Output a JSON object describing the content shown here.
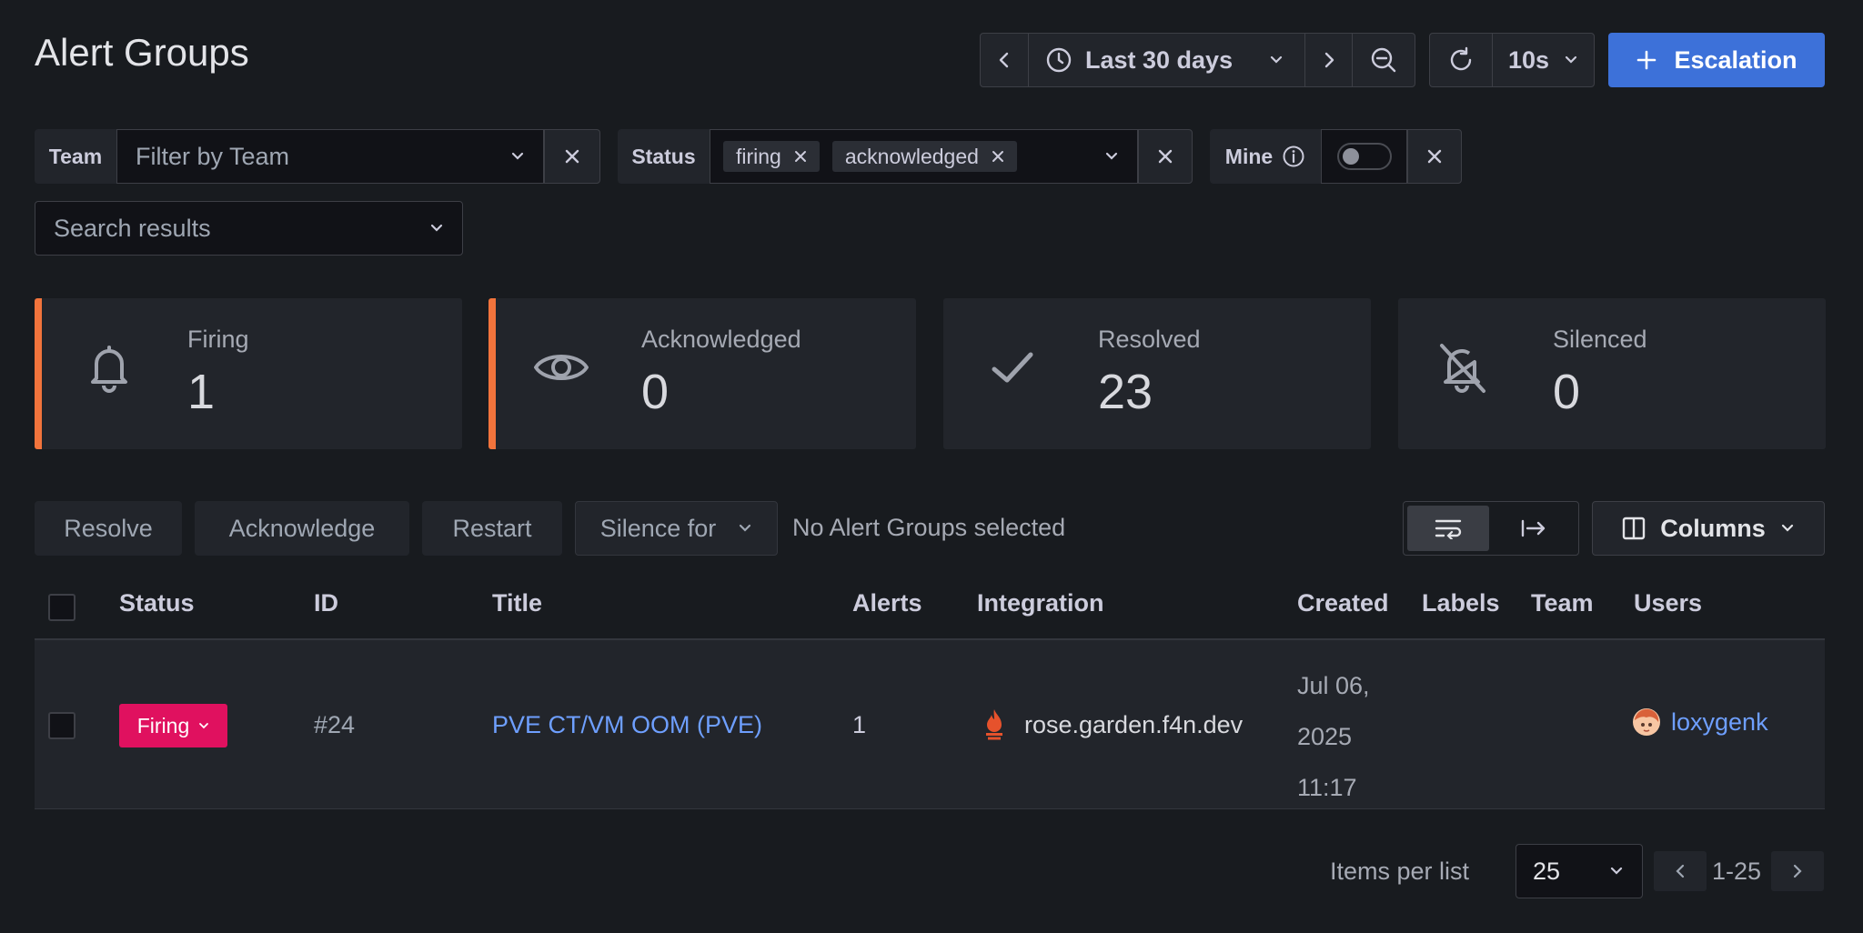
{
  "page": {
    "title": "Alert Groups"
  },
  "time_picker": {
    "range": "Last 30 days",
    "refresh_interval": "10s"
  },
  "escalation_button": {
    "label": "Escalation"
  },
  "filters": {
    "team": {
      "label": "Team",
      "placeholder": "Filter by Team"
    },
    "status": {
      "label": "Status",
      "chips": [
        "firing",
        "acknowledged"
      ]
    },
    "mine": {
      "label": "Mine",
      "enabled": false
    },
    "search": {
      "placeholder": "Search results"
    }
  },
  "stats": [
    {
      "label": "Firing",
      "value": "1",
      "icon": "bell-icon",
      "accent": true
    },
    {
      "label": "Acknowledged",
      "value": "0",
      "icon": "eye-icon",
      "accent": true
    },
    {
      "label": "Resolved",
      "value": "23",
      "icon": "check-icon",
      "accent": false
    },
    {
      "label": "Silenced",
      "value": "0",
      "icon": "bell-slash-icon",
      "accent": false
    }
  ],
  "bulk_actions": {
    "resolve": "Resolve",
    "acknowledge": "Acknowledge",
    "restart": "Restart",
    "silence_for": "Silence for",
    "selection_text": "No Alert Groups selected"
  },
  "columns_button": {
    "label": "Columns"
  },
  "table": {
    "headers": [
      "Status",
      "ID",
      "Title",
      "Alerts",
      "Integration",
      "Created",
      "Labels",
      "Team",
      "Users"
    ],
    "rows": [
      {
        "status": "Firing",
        "id": "#24",
        "title": "PVE CT/VM OOM (PVE)",
        "alerts": "1",
        "integration": "rose.garden.f4n.dev",
        "created": [
          "Jul 06,",
          "2025",
          "11:17"
        ],
        "labels": "",
        "team": "",
        "user": "loxygenk"
      }
    ]
  },
  "pagination": {
    "items_per_list_label": "Items per list",
    "per_page": "25",
    "range": "1-25"
  },
  "colors": {
    "accent_orange": "#f2743c",
    "firing_badge": "#e0115f",
    "primary_button": "#3d71d9",
    "link": "#6e9fff"
  }
}
